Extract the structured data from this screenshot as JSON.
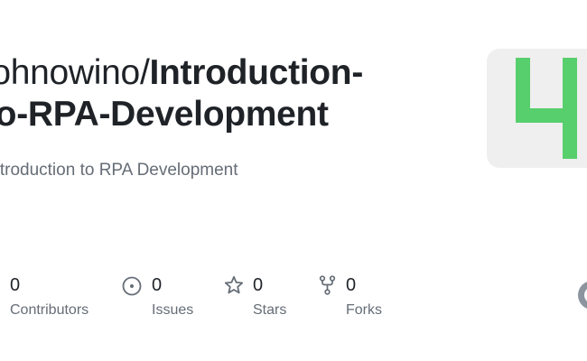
{
  "repo": {
    "owner": "johnowino",
    "separator": "/",
    "name": "Introduction-to-RPA-Development",
    "name_line1": "Introduction-",
    "name_line2": "to-RPA-Development",
    "description": "Introduction to RPA Development"
  },
  "stats": {
    "contributors": {
      "count": "0",
      "label": "Contributors"
    },
    "issues": {
      "count": "0",
      "label": "Issues",
      "icon": "issue-opened-icon"
    },
    "stars": {
      "count": "0",
      "label": "Stars",
      "icon": "star-icon"
    },
    "forks": {
      "count": "0",
      "label": "Forks",
      "icon": "repo-forked-icon"
    }
  },
  "colors": {
    "avatar_accent": "#57cf6d",
    "avatar_bg": "#efefef",
    "text_primary": "#1f2328",
    "text_secondary": "#656d76",
    "icon_gray": "#656d76"
  }
}
